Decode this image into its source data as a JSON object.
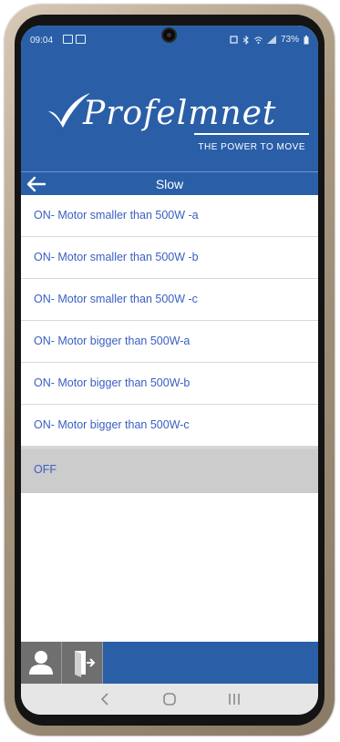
{
  "status_bar": {
    "time": "09:04",
    "battery": "73%"
  },
  "brand": {
    "logo": "Profelmnet",
    "tagline": "THE POWER TO MOVE"
  },
  "header": {
    "title": "Slow"
  },
  "options": [
    {
      "label": "ON- Motor smaller than 500W -a"
    },
    {
      "label": "ON- Motor smaller than 500W -b"
    },
    {
      "label": "ON- Motor smaller than 500W -c"
    },
    {
      "label": "ON- Motor bigger than 500W-a"
    },
    {
      "label": "ON- Motor bigger than 500W-b"
    },
    {
      "label": "ON- Motor bigger than 500W-c"
    },
    {
      "label": "OFF",
      "selected": true
    }
  ],
  "bottom_bar": {
    "icons": [
      "user-icon",
      "logout-icon"
    ]
  },
  "nav_bar": {
    "icons": [
      "back-nav-icon",
      "home-nav-icon",
      "recents-nav-icon"
    ]
  },
  "colors": {
    "brand_blue": "#2a5fa8",
    "option_text": "#3a5fc2",
    "selected_row": "#cccccc"
  }
}
